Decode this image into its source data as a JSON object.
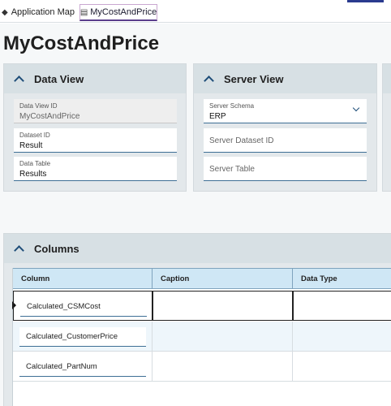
{
  "tabs": {
    "app_map_label": "Application Map",
    "app_map_icon": "layers-icon",
    "current_label": "MyCostAndPrice",
    "current_icon": "page-icon"
  },
  "page": {
    "title": "MyCostAndPrice"
  },
  "data_view": {
    "title": "Data View",
    "fields": [
      {
        "label": "Data View ID",
        "value": "MyCostAndPrice",
        "readonly": true
      },
      {
        "label": "Dataset ID",
        "value": "Result"
      },
      {
        "label": "Data Table",
        "value": "Results"
      }
    ]
  },
  "server_view": {
    "title": "Server View",
    "schema_label": "Server Schema",
    "schema_value": "ERP",
    "dataset_placeholder": "Server Dataset ID",
    "table_placeholder": "Server Table"
  },
  "columns": {
    "title": "Columns",
    "headers": [
      "Column",
      "Caption",
      "Data Type"
    ],
    "rows": [
      {
        "column": "Calculated_CSMCost",
        "caption": "",
        "data_type": ""
      },
      {
        "column": "Calculated_CustomerPrice",
        "caption": "",
        "data_type": ""
      },
      {
        "column": "Calculated_PartNum",
        "caption": "",
        "data_type": ""
      }
    ]
  },
  "colors": {
    "accent": "#1f4e79",
    "header_bg": "#cfe7f5",
    "panel_bg": "#e3e8eb",
    "tab_border": "#5a3e8c"
  }
}
